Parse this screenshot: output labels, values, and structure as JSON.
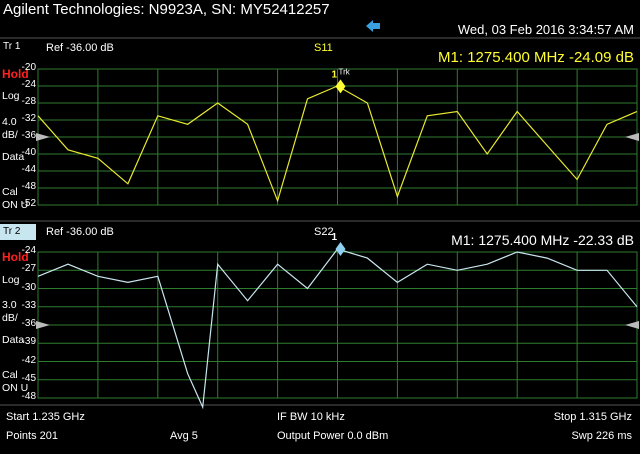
{
  "header": {
    "title": "Agilent Technologies: N9923A, SN: MY52412257",
    "datetime": "Wed, 03 Feb 2016 3:34:57 AM"
  },
  "trace1": {
    "tr_label": "Tr 1",
    "ref": "Ref -36.00 dB",
    "param": "S11",
    "marker_readout": "M1:  1275.400 MHz  -24.09 dB",
    "marker_label": "1",
    "marker_tag": "Trk",
    "status": "Hold",
    "format": "Log",
    "scale": "4.0",
    "scale_unit": "dB/",
    "data": "Data",
    "cal": "Cal",
    "cal_state": "ON U",
    "ticks": [
      "-20",
      "-24",
      "-28",
      "-32",
      "-36",
      "-40",
      "-44",
      "-48",
      "-52"
    ],
    "trace_color": "#e8e830"
  },
  "trace2": {
    "tr_label": "Tr 2",
    "ref": "Ref -36.00 dB",
    "param": "S22",
    "marker_readout": "M1:  1275.400 MHz  -22.33 dB",
    "marker_label": "1",
    "status": "Hold",
    "format": "Log",
    "scale": "3.0",
    "scale_unit": "dB/",
    "data": "Data",
    "cal": "Cal",
    "cal_state": "ON U",
    "ticks": [
      "-24",
      "-27",
      "-30",
      "-33",
      "-36",
      "-39",
      "-42",
      "-45",
      "-48"
    ],
    "trace_color": "#c8e6f0"
  },
  "footer": {
    "start": "Start 1.235 GHz",
    "ifbw": "IF BW 10 kHz",
    "stop": "Stop 1.315 GHz",
    "points": "Points 201",
    "avg": "Avg  5",
    "power": "Output Power 0.0 dBm",
    "sweep": "Swp 226 ms"
  },
  "colors": {
    "grid": "#2e7d2e",
    "hold": "#ff2020",
    "marker_yellow": "#ffff33",
    "marker_blue": "#8fd0f0"
  },
  "chart_data": [
    {
      "type": "line",
      "x_range_ghz": [
        1.235,
        1.315
      ],
      "ylim": [
        -52,
        -20
      ],
      "ref_level": -36,
      "x": [
        1.235,
        1.239,
        1.243,
        1.247,
        1.251,
        1.255,
        1.259,
        1.263,
        1.267,
        1.271,
        1.275,
        1.279,
        1.283,
        1.287,
        1.291,
        1.295,
        1.299,
        1.303,
        1.307,
        1.311,
        1.315
      ],
      "y": [
        -31,
        -39,
        -41,
        -47,
        -31,
        -33,
        -28,
        -33,
        -51,
        -27,
        -24,
        -28,
        -50,
        -31,
        -30,
        -40,
        -30,
        -38,
        -46,
        -33,
        -30
      ],
      "marker": {
        "x": 1.2754,
        "y": -24.09
      }
    },
    {
      "type": "line",
      "x_range_ghz": [
        1.235,
        1.315
      ],
      "ylim": [
        -48,
        -24
      ],
      "ref_level": -36,
      "x": [
        1.235,
        1.239,
        1.243,
        1.247,
        1.251,
        1.255,
        1.257,
        1.259,
        1.263,
        1.267,
        1.271,
        1.275,
        1.279,
        1.283,
        1.287,
        1.291,
        1.295,
        1.299,
        1.303,
        1.307,
        1.311,
        1.315
      ],
      "y": [
        -28,
        -26,
        -28,
        -29,
        -28,
        -44,
        -50,
        -26,
        -32,
        -26,
        -30,
        -23,
        -25,
        -29,
        -26,
        -27,
        -26,
        -24,
        -25,
        -27,
        -27,
        -33
      ],
      "marker": {
        "x": 1.2754,
        "y": -22.33
      }
    }
  ]
}
